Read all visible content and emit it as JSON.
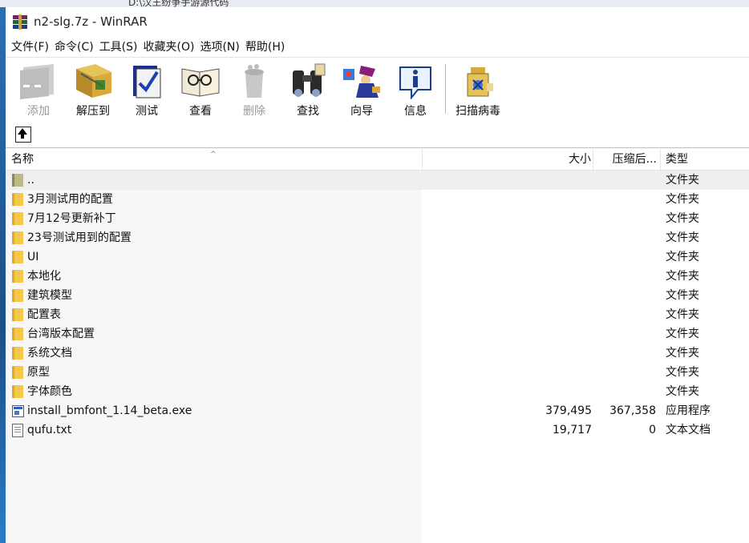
{
  "background_window": {
    "path_text": "D:\\汉王纷争手游源代码"
  },
  "window": {
    "title": "n2-slg.7z - WinRAR"
  },
  "menu": [
    "文件(F)",
    "命令(C)",
    "工具(S)",
    "收藏夹(O)",
    "选项(N)",
    "帮助(H)"
  ],
  "toolbar": [
    {
      "label": "添加",
      "icon": "add-books-icon",
      "enabled": false
    },
    {
      "label": "解压到",
      "icon": "extract-to-icon",
      "enabled": true
    },
    {
      "label": "测试",
      "icon": "test-icon",
      "enabled": true
    },
    {
      "label": "查看",
      "icon": "view-icon",
      "enabled": true
    },
    {
      "label": "删除",
      "icon": "delete-icon",
      "enabled": false
    },
    {
      "label": "查找",
      "icon": "find-binoculars-icon",
      "enabled": true
    },
    {
      "label": "向导",
      "icon": "wizard-icon",
      "enabled": true
    },
    {
      "label": "信息",
      "icon": "info-icon",
      "enabled": true
    },
    {
      "label": "扫描病毒",
      "icon": "virus-scan-icon",
      "enabled": true
    }
  ],
  "columns": {
    "name": "名称",
    "size": "大小",
    "packed": "压缩后...",
    "type": "类型"
  },
  "files": [
    {
      "name": "..",
      "size": "",
      "packed": "",
      "type": "文件夹",
      "icon": "folder-up"
    },
    {
      "name": "3月测试用的配置",
      "size": "",
      "packed": "",
      "type": "文件夹",
      "icon": "folder"
    },
    {
      "name": "7月12号更新补丁",
      "size": "",
      "packed": "",
      "type": "文件夹",
      "icon": "folder"
    },
    {
      "name": "23号测试用到的配置",
      "size": "",
      "packed": "",
      "type": "文件夹",
      "icon": "folder"
    },
    {
      "name": "UI",
      "size": "",
      "packed": "",
      "type": "文件夹",
      "icon": "folder"
    },
    {
      "name": "本地化",
      "size": "",
      "packed": "",
      "type": "文件夹",
      "icon": "folder"
    },
    {
      "name": "建筑模型",
      "size": "",
      "packed": "",
      "type": "文件夹",
      "icon": "folder"
    },
    {
      "name": "配置表",
      "size": "",
      "packed": "",
      "type": "文件夹",
      "icon": "folder"
    },
    {
      "name": "台湾版本配置",
      "size": "",
      "packed": "",
      "type": "文件夹",
      "icon": "folder"
    },
    {
      "name": "系统文档",
      "size": "",
      "packed": "",
      "type": "文件夹",
      "icon": "folder"
    },
    {
      "name": "原型",
      "size": "",
      "packed": "",
      "type": "文件夹",
      "icon": "folder"
    },
    {
      "name": "字体颜色",
      "size": "",
      "packed": "",
      "type": "文件夹",
      "icon": "folder"
    },
    {
      "name": "install_bmfont_1.14_beta.exe",
      "size": "379,495",
      "packed": "367,358",
      "type": "应用程序",
      "icon": "exe"
    },
    {
      "name": "qufu.txt",
      "size": "19,717",
      "packed": "0",
      "type": "文本文档",
      "icon": "txt"
    }
  ]
}
